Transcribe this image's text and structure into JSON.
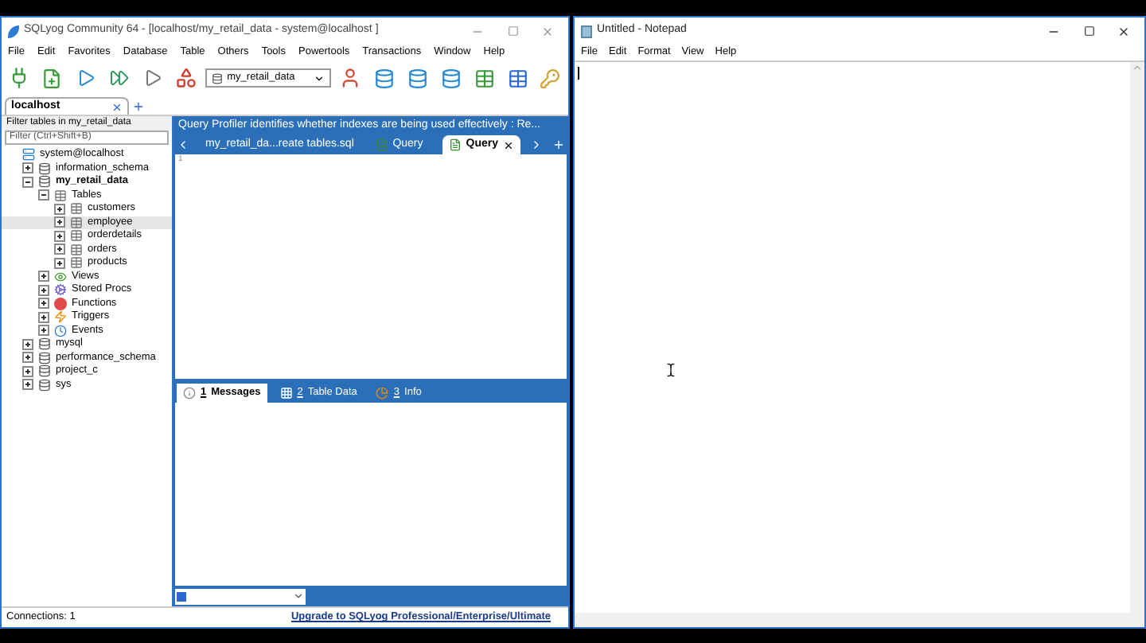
{
  "sqlyog": {
    "title": "SQLyog Community 64 - [localhost/my_retail_data - system@localhost ]",
    "menu": [
      "File",
      "Edit",
      "Favorites",
      "Database",
      "Table",
      "Others",
      "Tools",
      "Powertools",
      "Transactions",
      "Window",
      "Help"
    ],
    "database_select": {
      "value": "my_retail_data"
    },
    "connection_tabs": [
      {
        "label": "localhost",
        "selected": true
      }
    ],
    "filter": {
      "label": "Filter tables in my_retail_data",
      "placeholder": "Filter (Ctrl+Shift+B)"
    },
    "tree": [
      {
        "kind": "server",
        "label": "system@localhost",
        "selected": false,
        "children": [
          {
            "kind": "database",
            "label": "information_schema",
            "expanded": false,
            "active": false,
            "selected": false
          },
          {
            "kind": "database",
            "label": "my_retail_data",
            "expanded": true,
            "active": true,
            "selected": false,
            "children": [
              {
                "kind": "tables",
                "label": "Tables",
                "expanded": true,
                "selected": false,
                "children": [
                  {
                    "kind": "table",
                    "label": "customers",
                    "expanded": false,
                    "selected": false
                  },
                  {
                    "kind": "table",
                    "label": "employee",
                    "expanded": false,
                    "selected": true
                  },
                  {
                    "kind": "table",
                    "label": "orderdetails",
                    "expanded": false,
                    "selected": false
                  },
                  {
                    "kind": "table",
                    "label": "orders",
                    "expanded": false,
                    "selected": false
                  },
                  {
                    "kind": "table",
                    "label": "products",
                    "expanded": false,
                    "selected": false
                  }
                ]
              },
              {
                "kind": "views",
                "label": "Views",
                "expanded": false,
                "selected": false
              },
              {
                "kind": "procs",
                "label": "Stored Procs",
                "expanded": false,
                "selected": false
              },
              {
                "kind": "functions",
                "label": "Functions",
                "expanded": false,
                "selected": false
              },
              {
                "kind": "triggers",
                "label": "Triggers",
                "expanded": false,
                "selected": false
              },
              {
                "kind": "events",
                "label": "Events",
                "expanded": false,
                "selected": false
              }
            ]
          },
          {
            "kind": "database",
            "label": "mysql",
            "expanded": false,
            "active": false,
            "selected": false
          },
          {
            "kind": "database",
            "label": "performance_schema",
            "expanded": false,
            "active": false,
            "selected": false
          },
          {
            "kind": "database",
            "label": "project_c",
            "expanded": false,
            "active": false,
            "selected": false
          },
          {
            "kind": "database",
            "label": "sys",
            "expanded": false,
            "active": false,
            "selected": false
          }
        ]
      }
    ],
    "banner": "Query Profiler identifies whether indexes are being used effectively : Re...",
    "query_tabs": [
      {
        "label": "my_retail_da...reate tables.sql",
        "kind": "file",
        "selected": false
      },
      {
        "label": "Query",
        "kind": "query",
        "selected": false
      },
      {
        "label": "Query",
        "kind": "query",
        "selected": true
      }
    ],
    "editor": {
      "line_numbers": [
        "1"
      ]
    },
    "result_tabs": [
      {
        "key": "1",
        "label": "Messages",
        "kind": "messages",
        "selected": true
      },
      {
        "key": "2",
        "label": "Table Data",
        "kind": "table",
        "selected": false
      },
      {
        "key": "3",
        "label": "Info",
        "kind": "info",
        "selected": false
      }
    ],
    "status_bar": {
      "connections": "Connections: 1",
      "upgrade_link": "Upgrade to SQLyog Professional/Enterprise/Ultimate"
    }
  },
  "notepad": {
    "title": "Untitled - Notepad",
    "menu": [
      "File",
      "Edit",
      "Format",
      "View",
      "Help"
    ]
  }
}
